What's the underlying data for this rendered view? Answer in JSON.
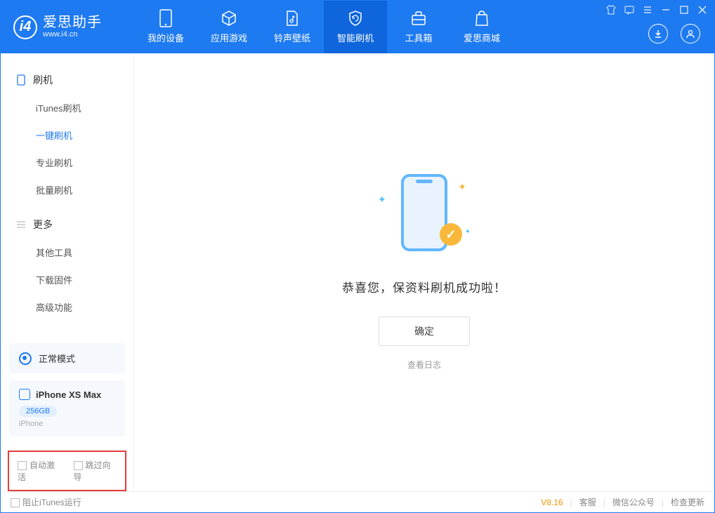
{
  "app": {
    "title": "爱思助手",
    "subtitle": "www.i4.cn"
  },
  "nav": {
    "tabs": [
      {
        "label": "我的设备"
      },
      {
        "label": "应用游戏"
      },
      {
        "label": "铃声壁纸"
      },
      {
        "label": "智能刷机"
      },
      {
        "label": "工具箱"
      },
      {
        "label": "爱思商城"
      }
    ]
  },
  "sidebar": {
    "section1_title": "刷机",
    "section1_items": [
      "iTunes刷机",
      "一键刷机",
      "专业刷机",
      "批量刷机"
    ],
    "section2_title": "更多",
    "section2_items": [
      "其他工具",
      "下载固件",
      "高级功能"
    ],
    "mode_label": "正常模式",
    "device_name": "iPhone XS Max",
    "device_storage": "256GB",
    "device_type": "iPhone",
    "checkbox1": "自动激活",
    "checkbox2": "跳过向导"
  },
  "main": {
    "success_text": "恭喜您，保资料刷机成功啦！",
    "ok_button": "确定",
    "view_log": "查看日志"
  },
  "footer": {
    "block_itunes": "阻止iTunes运行",
    "version": "V8.16",
    "link1": "客服",
    "link2": "微信公众号",
    "link3": "检查更新"
  }
}
